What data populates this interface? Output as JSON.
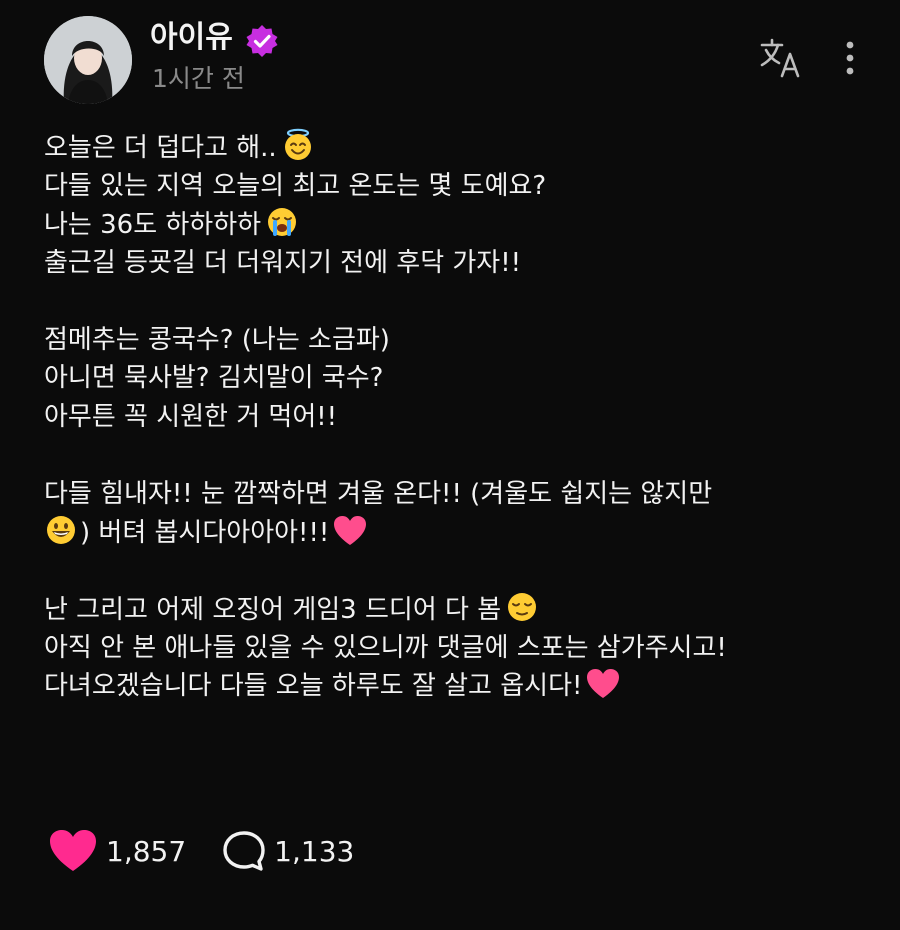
{
  "post": {
    "author": "아이유",
    "time": "1시간 전",
    "lines": {
      "l1": "오늘은 더 덥다고 해..",
      "l2": "다들 있는 지역 오늘의 최고 온도는 몇 도예요?",
      "l3": "나는 36도 하하하하",
      "l4": "출근길 등굣길 더 더워지기 전에 후닥 가자!!",
      "l5": "점메추는 콩국수? (나는 소금파)",
      "l6": "아니면 묵사발? 김치말이 국수?",
      "l7": "아무튼 꼭 시원한 거 먹어!!",
      "l8": "다들 힘내자!! 눈 깜짝하면 겨울 온다!! (겨울도 쉽지는 않지만",
      "l9": ") 버텨 봅시다아아아!!!",
      "l10": "난 그리고 어제 오징어 게임3 드디어 다 봄",
      "l11": "아직 안 본 애나들 있을 수 있으니까 댓글에 스포는 삼가주시고!",
      "l12": "다녀오겠습니다 다들 오늘 하루도 잘 살고 옵시다!"
    }
  },
  "actions": {
    "likes": "1,857",
    "replies": "1,133"
  },
  "icons": {
    "verified": "verified-badge-icon",
    "translate": "translate-icon",
    "more": "more-vertical-icon",
    "like": "heart-icon",
    "reply": "comment-bubble-icon"
  },
  "colors": {
    "background": "#0b0b0b",
    "verified_badge": "#c72ee0",
    "heart": "#ff2a8f",
    "muted_text": "#8a8a8a"
  }
}
